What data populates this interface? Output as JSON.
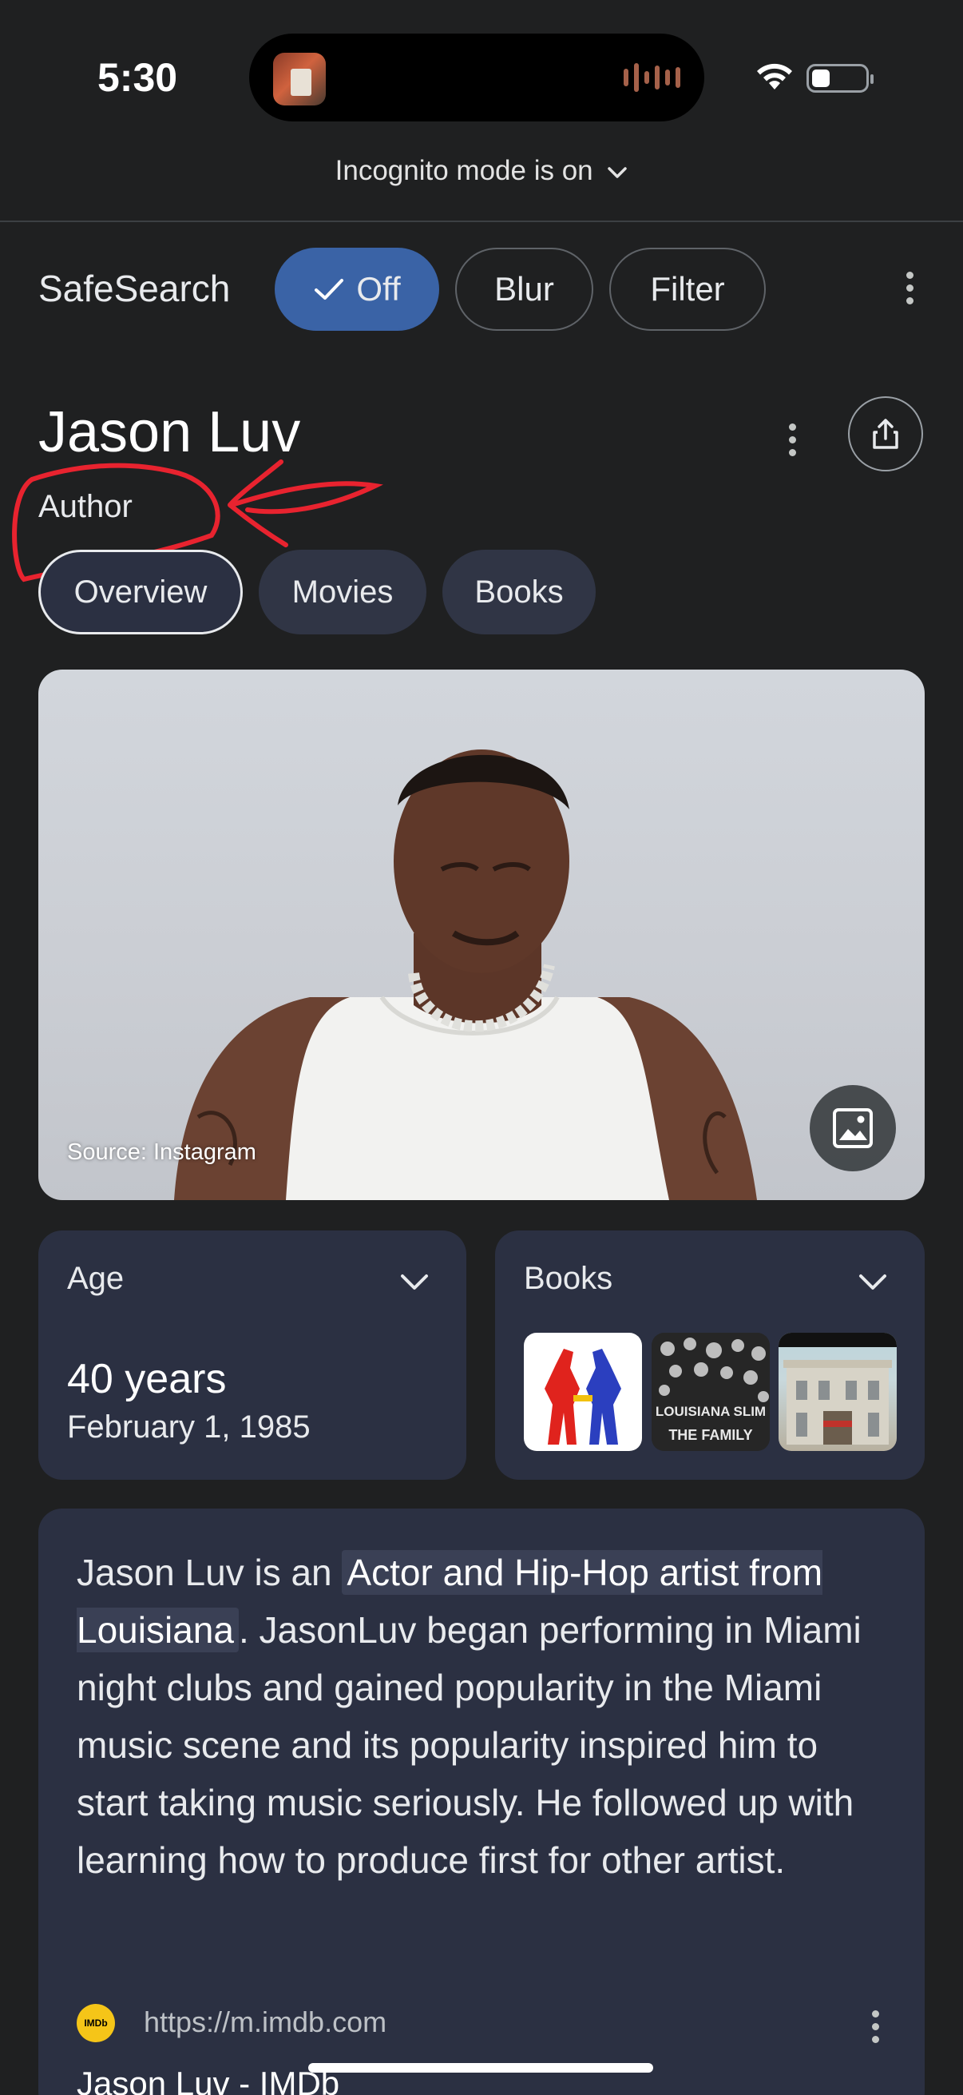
{
  "status_bar": {
    "time": "5:30"
  },
  "browser": {
    "incognito_text": "Incognito mode is on"
  },
  "safesearch": {
    "label": "SafeSearch",
    "options": [
      "Off",
      "Blur",
      "Filter"
    ],
    "selected": "Off"
  },
  "entity": {
    "name": "Jason Luv",
    "type": "Author",
    "tabs": [
      "Overview",
      "Movies",
      "Books"
    ],
    "active_tab": "Overview"
  },
  "hero": {
    "source": "Source: Instagram"
  },
  "age_card": {
    "label": "Age",
    "value": "40 years",
    "birth_date": "February 1, 1985"
  },
  "books_card": {
    "label": "Books"
  },
  "description": {
    "before": "Jason Luv is an ",
    "highlight": "Actor and Hip-Hop artist from Louisiana",
    "after": ". JasonLuv began performing in Miami night clubs and gained popularity in the Miami music scene and its popularity inspired him to start taking music seriously. He followed up with learning how to produce first for other artist."
  },
  "source_link": {
    "logo": "IMDb",
    "url": "https://m.imdb.com",
    "title": "Jason Luv - IMDb"
  },
  "colors": {
    "background": "#1f2021",
    "card": "#2b3042",
    "chip_selected": "#3a63a6",
    "annotation": "#e8232f"
  }
}
